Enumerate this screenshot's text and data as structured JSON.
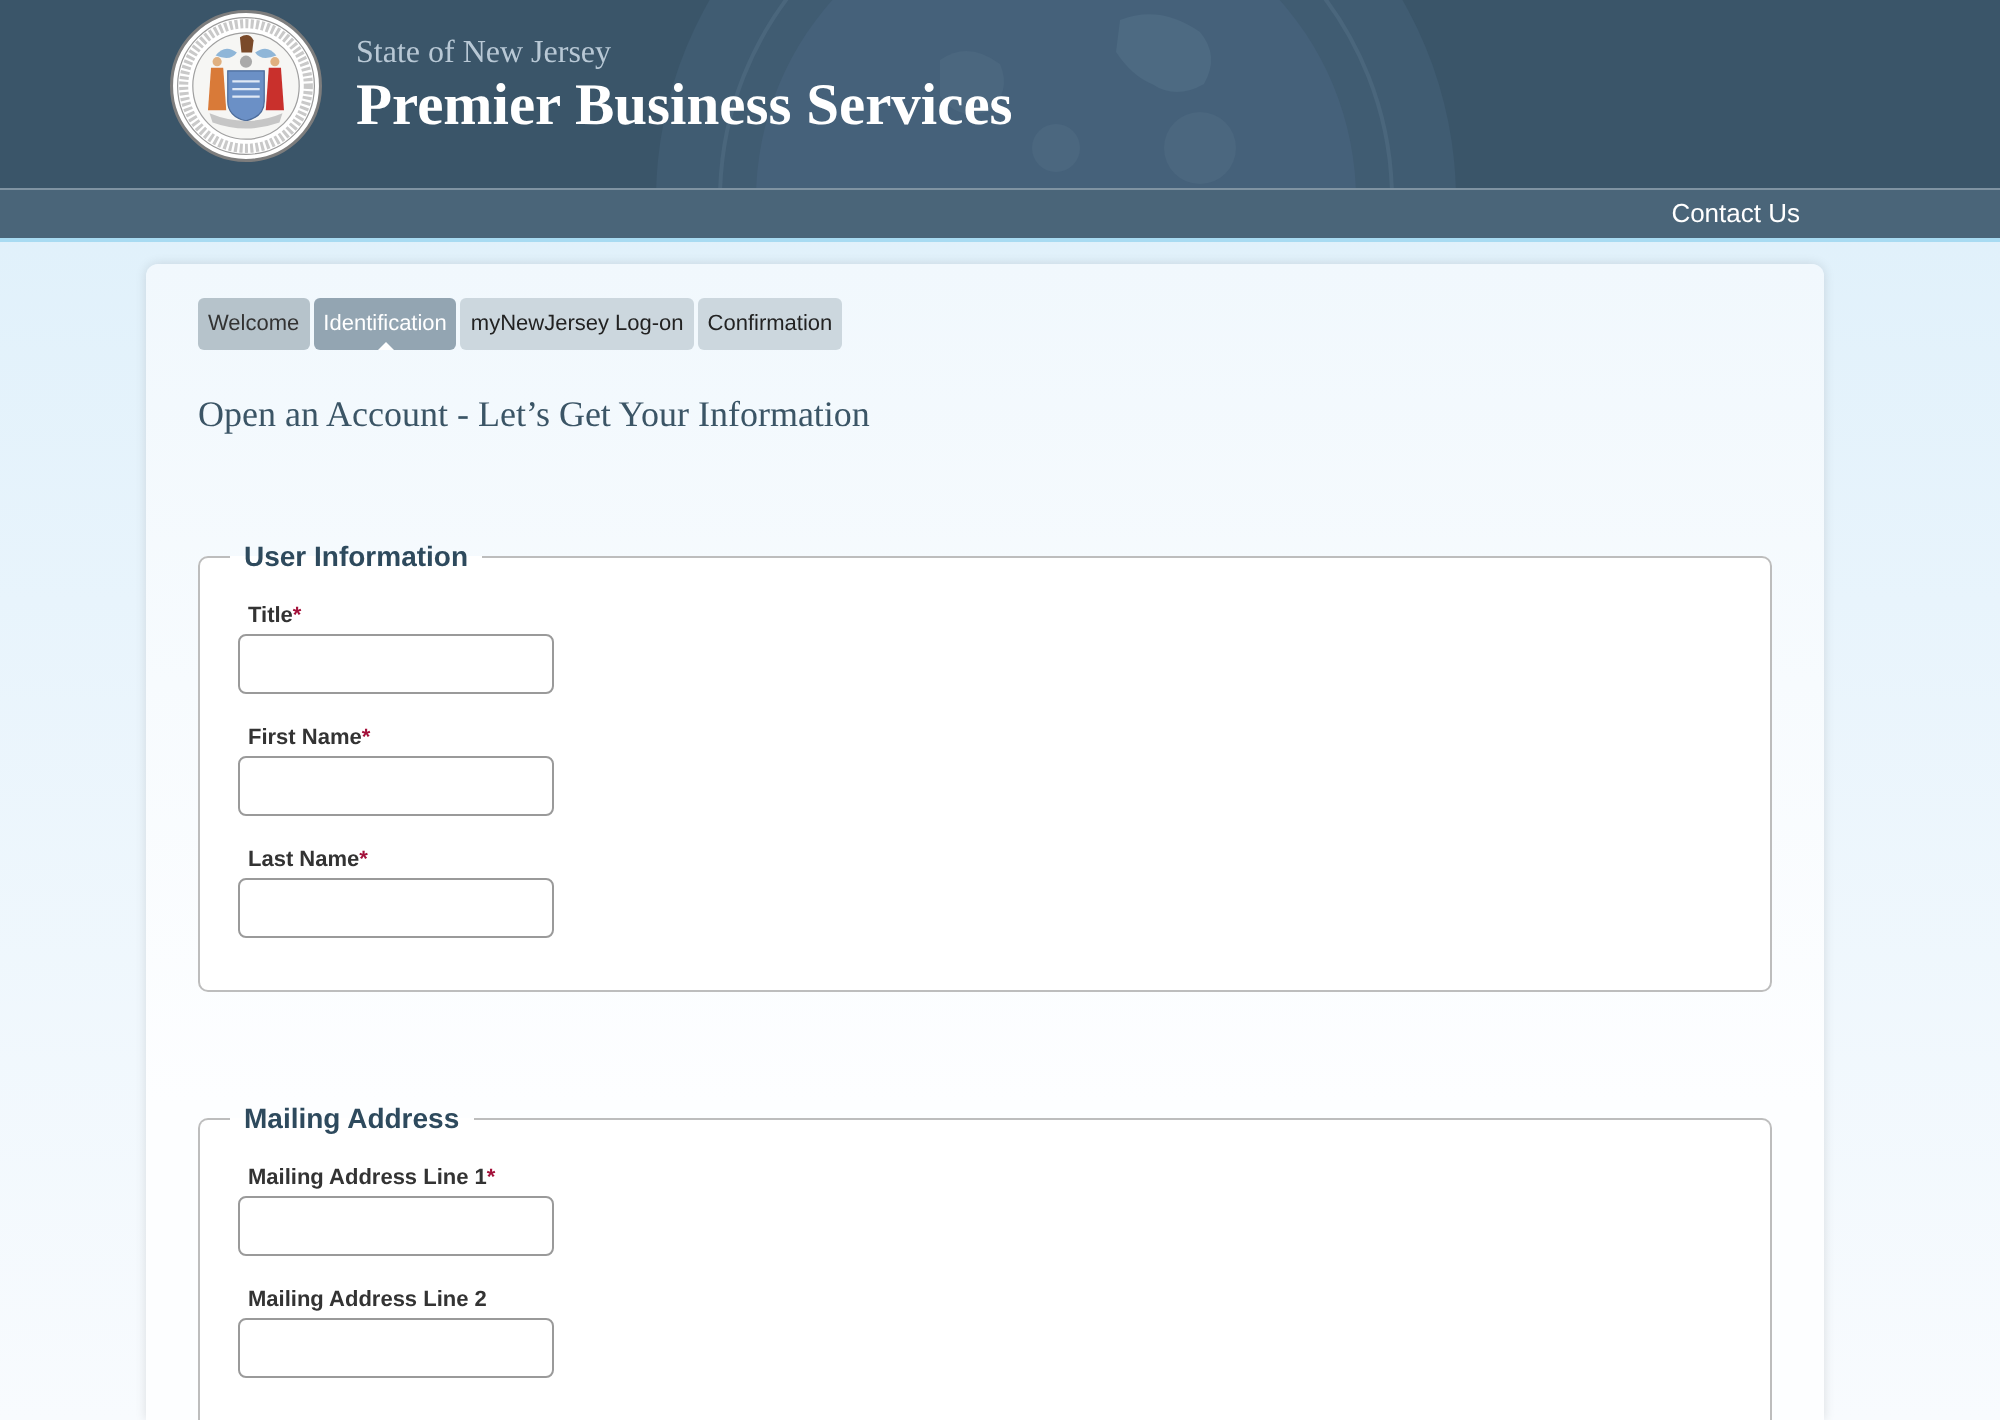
{
  "header": {
    "subtitle": "State of New Jersey",
    "title": "Premier Business Services"
  },
  "nav": {
    "links": [
      {
        "label": "Contact Us"
      }
    ]
  },
  "steps": [
    {
      "label": "Welcome",
      "selected": false,
      "completed": true
    },
    {
      "label": "Identification",
      "selected": true,
      "completed": false
    },
    {
      "label": "myNewJersey Log-on",
      "selected": false,
      "completed": false
    },
    {
      "label": "Confirmation",
      "selected": false,
      "completed": false
    }
  ],
  "heading": "Open an Account - Let’s Get Your Information",
  "sections": [
    {
      "legend": "User Information",
      "fields": [
        {
          "label": "Title",
          "required_mark": "*"
        },
        {
          "label": "First Name",
          "required_mark": "*"
        },
        {
          "label": "Last Name",
          "required_mark": "*"
        }
      ]
    },
    {
      "legend": "Mailing Address",
      "fields": [
        {
          "label": "Mailing Address Line 1",
          "required_mark": "*"
        },
        {
          "label": "Mailing Address Line 2"
        }
      ]
    }
  ]
}
